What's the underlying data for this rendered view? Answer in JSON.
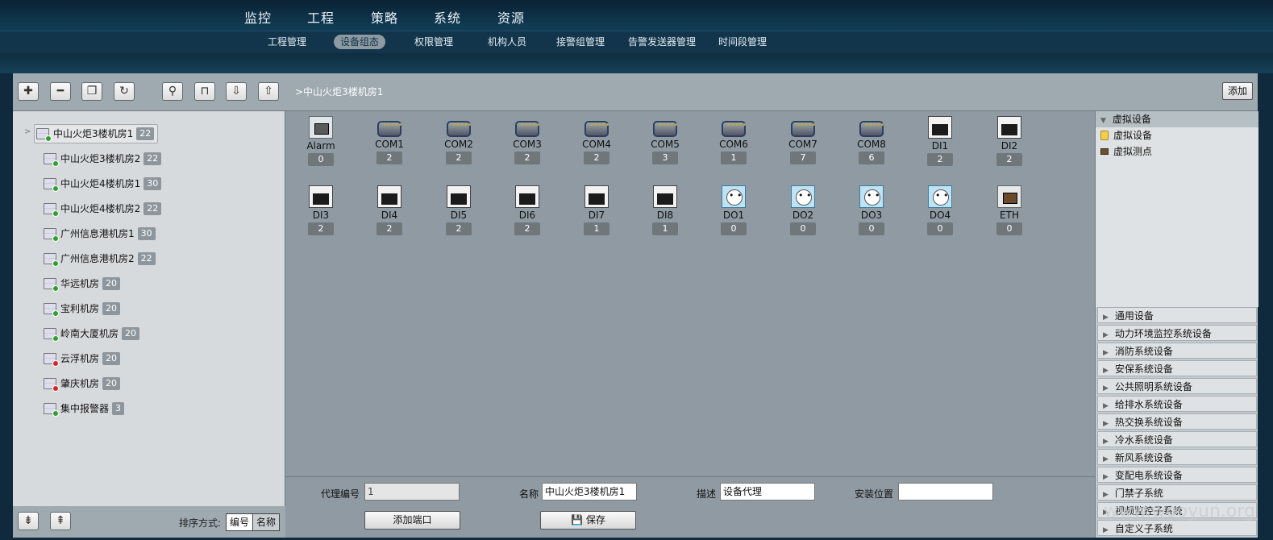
{
  "nav": {
    "main": [
      "监控",
      "工程",
      "策略",
      "系统",
      "资源"
    ],
    "sub": [
      "工程管理",
      "设备组态",
      "权限管理",
      "机构人员",
      "接警组管理",
      "告警发送器管理",
      "时间段管理"
    ],
    "active_sub": "设备组态"
  },
  "toolbar": [
    "add-icon",
    "remove-icon",
    "copy-icon",
    "refresh-icon",
    "search-icon",
    "network-icon",
    "import-icon",
    "export-icon"
  ],
  "tree": [
    {
      "label": "中山火炬3楼机房1",
      "count": "22",
      "status": "ok"
    },
    {
      "label": "中山火炬3楼机房2",
      "count": "22",
      "status": "ok"
    },
    {
      "label": "中山火炬4楼机房1",
      "count": "30",
      "status": "ok"
    },
    {
      "label": "中山火炬4楼机房2",
      "count": "22",
      "status": "ok"
    },
    {
      "label": "广州信息港机房1",
      "count": "30",
      "status": "ok"
    },
    {
      "label": "广州信息港机房2",
      "count": "22",
      "status": "ok"
    },
    {
      "label": "华远机房",
      "count": "20",
      "status": "ok"
    },
    {
      "label": "宝利机房",
      "count": "20",
      "status": "ok"
    },
    {
      "label": "岭南大厦机房",
      "count": "20",
      "status": "ok"
    },
    {
      "label": "云浮机房",
      "count": "20",
      "status": "error"
    },
    {
      "label": "肇庆机房",
      "count": "20",
      "status": "error"
    },
    {
      "label": "集中报警器",
      "count": "3",
      "status": "ok"
    }
  ],
  "sort": {
    "label": "排序方式:",
    "by_code": "编号",
    "by_name": "名称"
  },
  "header": {
    "path": ">中山火炬3楼机房1",
    "add_label": "添加"
  },
  "ports": [
    {
      "name": "Alarm",
      "count": "0",
      "type": "alarm"
    },
    {
      "name": "COM1",
      "count": "2",
      "type": "db9"
    },
    {
      "name": "COM2",
      "count": "2",
      "type": "db9"
    },
    {
      "name": "COM3",
      "count": "2",
      "type": "db9"
    },
    {
      "name": "COM4",
      "count": "2",
      "type": "db9"
    },
    {
      "name": "COM5",
      "count": "3",
      "type": "db9"
    },
    {
      "name": "COM6",
      "count": "1",
      "type": "db9"
    },
    {
      "name": "COM7",
      "count": "7",
      "type": "db9"
    },
    {
      "name": "COM8",
      "count": "6",
      "type": "db9"
    },
    {
      "name": "DI1",
      "count": "2",
      "type": "rjd"
    },
    {
      "name": "DI2",
      "count": "2",
      "type": "rjd"
    },
    {
      "name": "DI3",
      "count": "2",
      "type": "rjd"
    },
    {
      "name": "DI4",
      "count": "2",
      "type": "rjd"
    },
    {
      "name": "DI5",
      "count": "2",
      "type": "rjd"
    },
    {
      "name": "DI6",
      "count": "2",
      "type": "rjd"
    },
    {
      "name": "DI7",
      "count": "1",
      "type": "rjd"
    },
    {
      "name": "DI8",
      "count": "1",
      "type": "rjd"
    },
    {
      "name": "DO1",
      "count": "0",
      "type": "do"
    },
    {
      "name": "DO2",
      "count": "0",
      "type": "do"
    },
    {
      "name": "DO3",
      "count": "0",
      "type": "do"
    },
    {
      "name": "DO4",
      "count": "0",
      "type": "do"
    },
    {
      "name": "ETH",
      "count": "0",
      "type": "eth"
    }
  ],
  "form": {
    "agent_id_label": "代理编号",
    "agent_id_value": "1",
    "name_label": "名称",
    "name_value": "中山火炬3楼机房1",
    "desc_label": "描述",
    "desc_value": "设备代理",
    "location_label": "安装位置",
    "location_value": "",
    "add_port_label": "添加端口",
    "save_label": "保存"
  },
  "right": {
    "virtual_header": "虚拟设备",
    "virtual_items": [
      "虚拟设备",
      "虚拟测点"
    ],
    "categories": [
      "通用设备",
      "动力环境监控系统设备",
      "消防系统设备",
      "安保系统设备",
      "公共照明系统设备",
      "给排水系统设备",
      "热交换系统设备",
      "冷水系统设备",
      "新风系统设备",
      "变配电系统设备",
      "门禁子系统",
      "视频监控子系统",
      "自定义子系统"
    ]
  },
  "watermark": "www.wooyun.org"
}
